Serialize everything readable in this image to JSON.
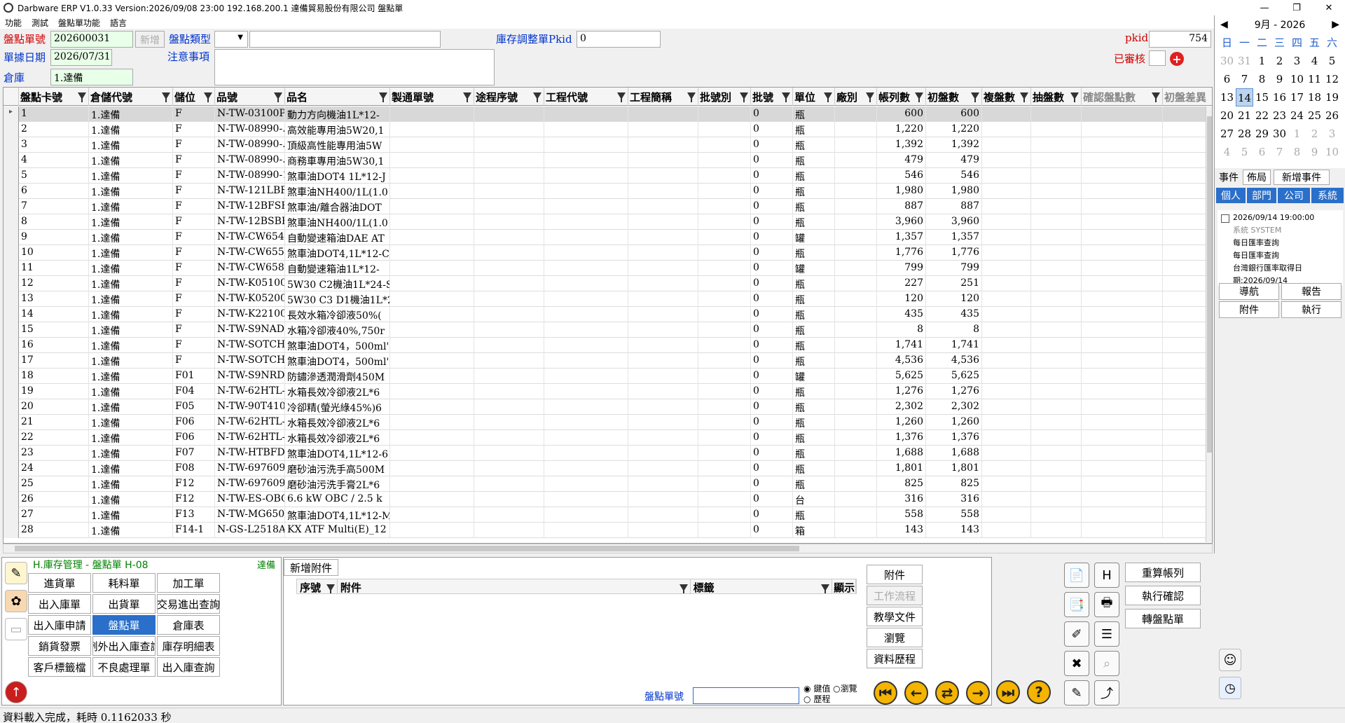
{
  "window": {
    "title": "Darbware ERP V1.0.33 Version:2026/09/08 23:00    192.168.200.1 達備貿易股份有限公司 盤點單"
  },
  "menu": [
    "功能",
    "測試",
    "盤點單功能",
    "語言"
  ],
  "form": {
    "doc_no_label": "盤點單號",
    "doc_no": "202600031",
    "new_button": "新增",
    "type_label": "盤點類型",
    "adj_label": "庫存調整單Pkid",
    "adj_value": "0",
    "pkid_label": "pkid",
    "pkid_value": "754",
    "date_label": "單據日期",
    "date_value": "2026/07/31",
    "note_label": "注意事項",
    "reviewed_label": "已審核",
    "warehouse_label": "倉庫",
    "warehouse_value": "1.達備"
  },
  "grid": {
    "columns": [
      "盤點卡號",
      "倉儲代號",
      "儲位",
      "品號",
      "品名",
      "製通單號",
      "途程序號",
      "工程代號",
      "工程簡稱",
      "批號別",
      "批號",
      "單位",
      "廠別",
      "帳列數",
      "初盤數",
      "複盤數",
      "抽盤數",
      "確認盤點數",
      "初盤差異"
    ],
    "rows": [
      [
        "1",
        "1.達備",
        "F",
        "N-TW-03100PI",
        "動力方向機油1L*12-",
        "",
        "",
        "",
        "",
        "",
        "0",
        "瓶",
        "",
        "600",
        "600"
      ],
      [
        "2",
        "1.達備",
        "F",
        "N-TW-08990-.",
        "高效能專用油5W20,1",
        "",
        "",
        "",
        "",
        "",
        "0",
        "瓶",
        "",
        "1,220",
        "1,220"
      ],
      [
        "3",
        "1.達備",
        "F",
        "N-TW-08990-.",
        "頂級高性能專用油5W",
        "",
        "",
        "",
        "",
        "",
        "0",
        "瓶",
        "",
        "1,392",
        "1,392"
      ],
      [
        "4",
        "1.達備",
        "F",
        "N-TW-08990-.",
        "商務車專用油5W30,1",
        "",
        "",
        "",
        "",
        "",
        "0",
        "瓶",
        "",
        "479",
        "479"
      ],
      [
        "5",
        "1.達備",
        "F",
        "N-TW-08990-1",
        "煞車油DOT4 1L*12-J",
        "",
        "",
        "",
        "",
        "",
        "0",
        "瓶",
        "",
        "546",
        "546"
      ],
      [
        "6",
        "1.達備",
        "F",
        "N-TW-121LBFI",
        "煞車油NH400/1L(1.0",
        "",
        "",
        "",
        "",
        "",
        "0",
        "瓶",
        "",
        "1,980",
        "1,980"
      ],
      [
        "7",
        "1.達備",
        "F",
        "N-TW-12BFSHI",
        "煞車油/離合器油DOT",
        "",
        "",
        "",
        "",
        "",
        "0",
        "瓶",
        "",
        "887",
        "887"
      ],
      [
        "8",
        "1.達備",
        "F",
        "N-TW-12BSBF-",
        "煞車油NH400/1L(1.0",
        "",
        "",
        "",
        "",
        "",
        "0",
        "瓶",
        "",
        "3,960",
        "3,960"
      ],
      [
        "9",
        "1.達備",
        "F",
        "N-TW-CW6548:",
        "自動變速箱油DAE AT",
        "",
        "",
        "",
        "",
        "",
        "0",
        "罐",
        "",
        "1,357",
        "1,357"
      ],
      [
        "10",
        "1.達備",
        "F",
        "N-TW-CW6551-",
        "煞車油DOT4,1L*12-C",
        "",
        "",
        "",
        "",
        "",
        "0",
        "瓶",
        "",
        "1,776",
        "1,776"
      ],
      [
        "11",
        "1.達備",
        "F",
        "N-TW-CW6583:",
        "自動變速箱油1L*12-",
        "",
        "",
        "",
        "",
        "",
        "0",
        "罐",
        "",
        "799",
        "799"
      ],
      [
        "12",
        "1.達備",
        "F",
        "N-TW-K05100I",
        "5W30 C2機油1L*24-S",
        "",
        "",
        "",
        "",
        "",
        "0",
        "瓶",
        "",
        "227",
        "251"
      ],
      [
        "13",
        "1.達備",
        "F",
        "N-TW-K05200",
        "5W30 C3 D1機油1L*2",
        "",
        "",
        "",
        "",
        "",
        "0",
        "瓶",
        "",
        "120",
        "120"
      ],
      [
        "14",
        "1.達備",
        "F",
        "N-TW-K22100",
        "長效水箱冷卻液50%(",
        "",
        "",
        "",
        "",
        "",
        "0",
        "瓶",
        "",
        "435",
        "435"
      ],
      [
        "15",
        "1.達備",
        "F",
        "N-TW-S9NAD7.",
        "水箱冷卻液40%,750r",
        "",
        "",
        "",
        "",
        "",
        "0",
        "瓶",
        "",
        "8",
        "8"
      ],
      [
        "16",
        "1.達備",
        "F",
        "N-TW-SOTCHO(",
        "煞車油DOT4，500ml'",
        "",
        "",
        "",
        "",
        "",
        "0",
        "瓶",
        "",
        "1,741",
        "1,741"
      ],
      [
        "17",
        "1.達備",
        "F",
        "N-TW-SOTCHO(",
        "煞車油DOT4，500ml'",
        "",
        "",
        "",
        "",
        "",
        "0",
        "瓶",
        "",
        "4,536",
        "4,536"
      ],
      [
        "18",
        "1.達備",
        "F01",
        "N-TW-S9NRD4.",
        "防鏽滲透潤滑劑450M",
        "",
        "",
        "",
        "",
        "",
        "0",
        "罐",
        "",
        "5,625",
        "5,625"
      ],
      [
        "19",
        "1.達備",
        "F04",
        "N-TW-62HTL-1",
        "水箱長效冷卻液2L*6",
        "",
        "",
        "",
        "",
        "",
        "0",
        "瓶",
        "",
        "1,276",
        "1,276"
      ],
      [
        "20",
        "1.達備",
        "F05",
        "N-TW-90T410(",
        "冷卻精(螢光綠45%)6",
        "",
        "",
        "",
        "",
        "",
        "0",
        "瓶",
        "",
        "2,302",
        "2,302"
      ],
      [
        "21",
        "1.達備",
        "F06",
        "N-TW-62HTL-1",
        "水箱長效冷卻液2L*6",
        "",
        "",
        "",
        "",
        "",
        "0",
        "瓶",
        "",
        "1,260",
        "1,260"
      ],
      [
        "22",
        "1.達備",
        "F06",
        "N-TW-62HTL-1",
        "水箱長效冷卻液2L*6",
        "",
        "",
        "",
        "",
        "",
        "0",
        "瓶",
        "",
        "1,376",
        "1,376"
      ],
      [
        "23",
        "1.達備",
        "F07",
        "N-TW-HTBFDO'",
        "煞車油DOT4,1L*12-6",
        "",
        "",
        "",
        "",
        "",
        "0",
        "瓶",
        "",
        "1,688",
        "1,688"
      ],
      [
        "24",
        "1.達備",
        "F08",
        "N-TW-697609:",
        "磨砂油污洗手高500M",
        "",
        "",
        "",
        "",
        "",
        "0",
        "瓶",
        "",
        "1,801",
        "1,801"
      ],
      [
        "25",
        "1.達備",
        "F12",
        "N-TW-697609:",
        "磨砂油污洗手膏2L*6",
        "",
        "",
        "",
        "",
        "",
        "0",
        "瓶",
        "",
        "825",
        "825"
      ],
      [
        "26",
        "1.達備",
        "F12",
        "N-TW-ES-OBO",
        "6.6 kW OBC / 2.5 k",
        "",
        "",
        "",
        "",
        "",
        "0",
        "台",
        "",
        "316",
        "316"
      ],
      [
        "27",
        "1.達備",
        "F13",
        "N-TW-MG6500(",
        "煞車油DOT4,1L*12-M",
        "",
        "",
        "",
        "",
        "",
        "0",
        "瓶",
        "",
        "558",
        "558"
      ],
      [
        "28",
        "1.達備",
        "F14-1",
        "N-GS-L2518Al",
        "KX ATF Multi(E)_12",
        "",
        "",
        "",
        "",
        "",
        "0",
        "箱",
        "",
        "143",
        "143"
      ]
    ]
  },
  "calendar": {
    "month": "9月",
    "year": "2026",
    "dow": [
      "日",
      "一",
      "二",
      "三",
      "四",
      "五",
      "六"
    ],
    "days": [
      [
        "30",
        "31",
        "1",
        "2",
        "3",
        "4",
        "5"
      ],
      [
        "6",
        "7",
        "8",
        "9",
        "10",
        "11",
        "12"
      ],
      [
        "13",
        "14",
        "15",
        "16",
        "17",
        "18",
        "19"
      ],
      [
        "20",
        "21",
        "22",
        "23",
        "24",
        "25",
        "26"
      ],
      [
        "27",
        "28",
        "29",
        "30",
        "1",
        "2",
        "3"
      ],
      [
        "4",
        "5",
        "6",
        "7",
        "8",
        "9",
        "10"
      ]
    ]
  },
  "events": {
    "tabs": [
      "事件",
      "佈局",
      "新增事件"
    ],
    "categories": [
      "個人",
      "部門",
      "公司",
      "系統"
    ],
    "item": {
      "datetime": "2026/09/14 19:00:00",
      "source": "系統  SYSTEM",
      "lines": [
        "每日匯率查詢",
        "每日匯率查詢",
        "台灣銀行匯率取得日",
        "期:2026/09/14"
      ]
    },
    "buttons": [
      "導航",
      "報告",
      "附件",
      "執行"
    ]
  },
  "nav": {
    "title": "H.庫存管理 - 盤點單  H-08",
    "company": "達備",
    "buttons": [
      "進貨單",
      "耗料單",
      "加工單",
      "出入庫單",
      "出貨單",
      "交易進出查詢",
      "出入庫申請",
      "盤點單",
      "倉庫表",
      "銷貨發票",
      "例外出入庫查詢",
      "庫存明細表",
      "客戶標籤檔",
      "不良處理單",
      "出入庫查詢"
    ]
  },
  "attachments": {
    "add_button": "新增附件",
    "columns": [
      "序號",
      "附件",
      "標籤",
      "顯示"
    ],
    "side_buttons": [
      "附件",
      "工作流程",
      "教學文件",
      "瀏覽",
      "資料歷程"
    ],
    "search_label": "盤點單號",
    "radio": [
      "鍵值",
      "瀏覽",
      "歷程"
    ]
  },
  "right_actions": [
    "重算帳列",
    "執行確認",
    "轉盤點單"
  ],
  "status": "資料載入完成，耗時 0.1162033 秒"
}
